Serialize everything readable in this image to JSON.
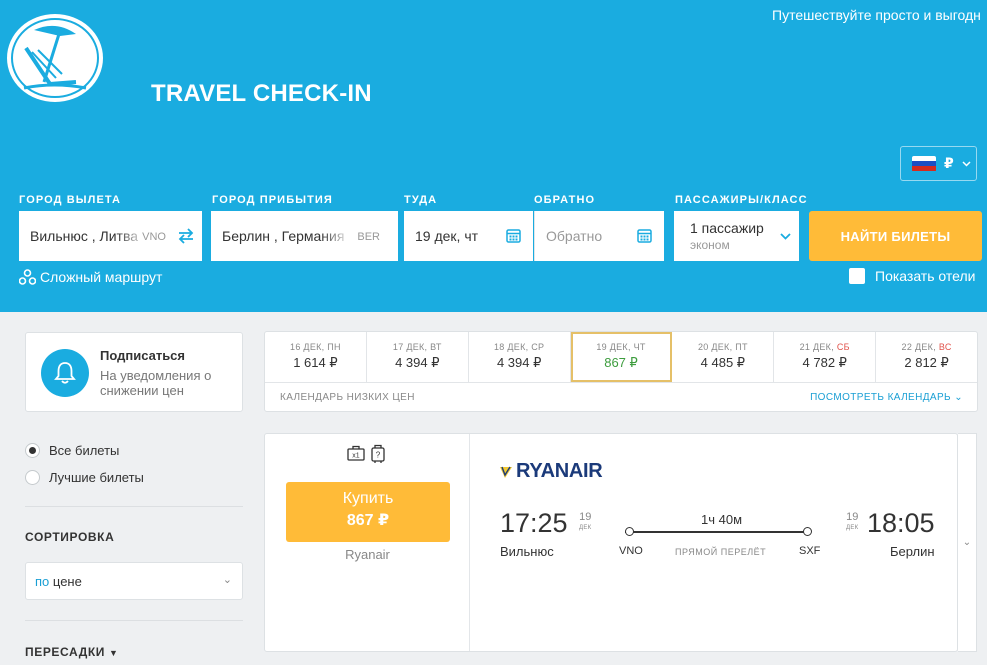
{
  "header": {
    "tagline": "Путешествуйте просто и выгодн",
    "brand": "TRAVEL CHECK-IN",
    "currency": "₽"
  },
  "search": {
    "origin": {
      "label": "ГОРОД ВЫЛЕТА",
      "value": "Вильнюс , Литва",
      "code": "VNO"
    },
    "destination": {
      "label": "ГОРОД ПРИБЫТИЯ",
      "value": "Берлин , Германия",
      "code": "BER"
    },
    "depart": {
      "label": "ТУДА",
      "value": "19 дек, чт"
    },
    "return": {
      "label": "ОБРАТНО",
      "placeholder": "Обратно"
    },
    "passengers": {
      "label": "ПАССАЖИРЫ/КЛАСС",
      "count": "1 пассажир",
      "class": "эконом"
    },
    "submit": "НАЙТИ БИЛЕТЫ",
    "complex_route": "Сложный маршрут",
    "show_hotels": "Показать отели"
  },
  "subscribe": {
    "title": "Подписаться",
    "text": "На уведомления о снижении цен"
  },
  "calendar": {
    "days": [
      {
        "date": "16 ДЕК, ПН",
        "price": "1 614 ₽"
      },
      {
        "date": "17 ДЕК, ВТ",
        "price": "4 394 ₽"
      },
      {
        "date": "18 ДЕК, СР",
        "price": "4 394 ₽"
      },
      {
        "date": "19 ДЕК, ЧТ",
        "price": "867 ₽"
      },
      {
        "date": "20 ДЕК, ПТ",
        "price": "4 485 ₽"
      },
      {
        "date": "21 ДЕК,",
        "weekday": "СБ",
        "price": "4 782 ₽"
      },
      {
        "date": "22 ДЕК,",
        "weekday": "ВС",
        "price": "2 812 ₽"
      }
    ],
    "footer": "КАЛЕНДАРЬ НИЗКИХ ЦЕН",
    "link": "ПОСМОТРЕТЬ КАЛЕНДАРЬ"
  },
  "filters": {
    "all_tickets": "Все билеты",
    "best_tickets": "Лучшие билеты",
    "sort_title": "СОРТИРОВКА",
    "sort_prefix": "по",
    "sort_value": "цене",
    "transfers_title": "ПЕРЕСАДКИ"
  },
  "ticket": {
    "buy_label": "Купить",
    "price": "867 ₽",
    "airline": "Ryanair",
    "airline_logo": "RYANAIR",
    "baggage_count": "x1",
    "carry_on": "?",
    "depart_time": "17:25",
    "depart_day": "19",
    "depart_month": "ДЕК",
    "depart_city": "Вильнюс",
    "depart_code": "VNO",
    "arrive_time": "18:05",
    "arrive_day": "19",
    "arrive_month": "ДЕК",
    "arrive_city": "Берлин",
    "arrive_code": "SXF",
    "duration": "1ч 40м",
    "direct": "ПРЯМОЙ ПЕРЕЛЁТ"
  }
}
